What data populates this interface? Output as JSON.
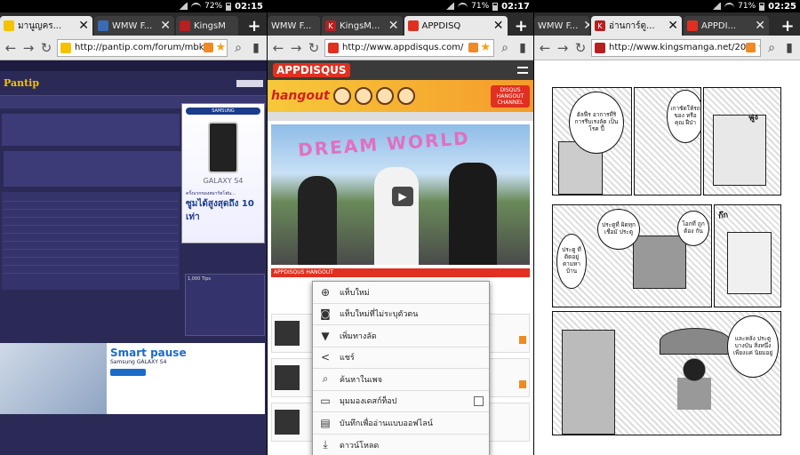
{
  "panels": [
    {
      "status": {
        "battery": "72%",
        "time": "02:15"
      },
      "tabs": [
        {
          "label": "มานูญคร...",
          "favicon_color": "#f4c200",
          "active": true
        },
        {
          "label": "WMW F...",
          "favicon_color": "#3a6ab8",
          "active": false
        },
        {
          "label": "KingsM",
          "favicon_color": "#b52020",
          "active": false
        }
      ],
      "url": "http://pantip.com/forum/mbk",
      "url_favicon_color": "#f4c200"
    },
    {
      "status": {
        "battery": "71%",
        "time": "02:17"
      },
      "tabs": [
        {
          "label": "WMW F...",
          "favicon_color": "#3a6ab8",
          "active": false
        },
        {
          "label": "KingsM...",
          "favicon_color": "#b52020",
          "active": false
        },
        {
          "label": "APPDISQ",
          "favicon_color": "#e03020",
          "active": true
        }
      ],
      "url": "http://www.appdisqus.com/",
      "url_favicon_color": "#e03020"
    },
    {
      "status": {
        "battery": "71%",
        "time": "02:25"
      },
      "tabs": [
        {
          "label": "WMW F...",
          "favicon_color": "#3a6ab8",
          "active": false
        },
        {
          "label": "อ่านการ์ตู...",
          "favicon_color": "#b52020",
          "active": true
        },
        {
          "label": "APPDI...",
          "favicon_color": "#e03020",
          "active": false
        }
      ],
      "url": "http://www.kingsmanga.net/20",
      "url_favicon_color": "#b52020"
    }
  ],
  "pantip": {
    "logo": "Pantip",
    "samsung_logo": "SAMSUNG",
    "galaxy": "GALAXY S4",
    "promo": "ครั้งแรกของสมาร์ทโฟน...",
    "promo_big": "ซูมได้สูงสุดถึง 10 เท่า",
    "tips_title": "1,000 Tips",
    "ad_title": "Smart pause",
    "ad_galaxy": "Samsung GALAXY S4"
  },
  "appdisqus": {
    "logo": "APPDISQUS",
    "banner": "hangout",
    "badge": "DISQUS HANGOUT CHANNEL",
    "video_text": "DREAM WORLD",
    "redbar": "APPDISQUS HANGOUT"
  },
  "context_menu": [
    {
      "label": "แท็บใหม่",
      "icon": "globe-plus-icon"
    },
    {
      "label": "แท็บใหม่ที่ไม่ระบุตัวตน",
      "icon": "incognito-tab-icon"
    },
    {
      "label": "เพิ่มทางลัด",
      "icon": "bookmark-add-icon"
    },
    {
      "label": "แชร์",
      "icon": "share-icon"
    },
    {
      "label": "ค้นหาในเพจ",
      "icon": "search-icon"
    },
    {
      "label": "มุมมองเดสก์ท็อป",
      "icon": "desktop-view-icon",
      "checkbox": true
    },
    {
      "label": "บันทึกเพื่ออ่านแบบออฟไลน์",
      "icon": "save-offline-icon"
    },
    {
      "label": "ดาวน์โหลด",
      "icon": "download-icon"
    }
  ],
  "manga": {
    "b1": "ฮัลฟี่ร อาการที่ริ การรีบเรงลัต เป็นโรค ปี้",
    "b2": "เกาชัดให้รถของ หรือคุณ ฝีป่า",
    "b3": "ประตูที่ ผิดทุกเชื่อมั ประตู",
    "b4": "โอกที่ ถูกต้อง กัน",
    "b5": "ประตู ที่ ติดอยู่ ตามหา บ้าน",
    "b6": "และหลัง ประตูบางบัน สิ่งหนึ่ง เพียงแค่ นิยมอยู่",
    "sfx1": "ฟูง",
    "sfx2": "ก๊ก"
  }
}
